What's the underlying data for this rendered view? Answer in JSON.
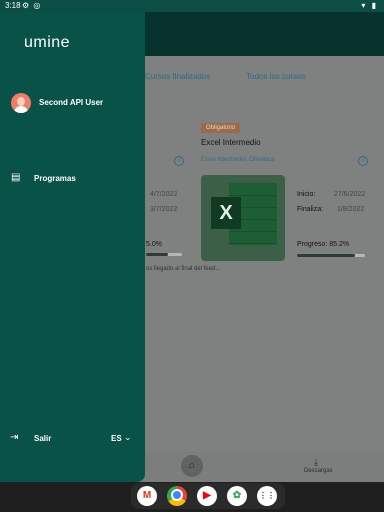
{
  "status_bar": {
    "time": "3:18"
  },
  "drawer": {
    "logo": "umine",
    "user_name": "Second API User",
    "menu_items": [
      {
        "label": "Programas",
        "icon": "book-icon"
      }
    ],
    "logout_label": "Salir",
    "language": "ES"
  },
  "tabs": [
    "Cursos finalizados",
    "Todos los cursos"
  ],
  "course": {
    "badge": "Obligatorio",
    "title": "Excel Intermedio",
    "subtitle": "Excel Intermedio, Ofimática",
    "start_label": "Inicio:",
    "start_date": "27/6/2022",
    "end_label": "Finaliza:",
    "end_date": "1/8/2022",
    "progress_label": "Progreso: 85.2%",
    "progress_fraction": 0.852
  },
  "partial_course": {
    "start_date": "4/7/2022",
    "end_date": "3/7/2022",
    "progress_label": "5.0%",
    "progress_fraction": 0.6
  },
  "end_of_feed": "os llegado al final del feed...",
  "bottom_nav": {
    "downloads_label": "Descargas"
  },
  "dock_apps": [
    "Gmail",
    "Chrome",
    "YouTube",
    "Photos",
    "Apps"
  ],
  "colors": {
    "drawer_bg": "#095247",
    "accent": "#2f6c80",
    "badge": "#9b6a4a"
  }
}
